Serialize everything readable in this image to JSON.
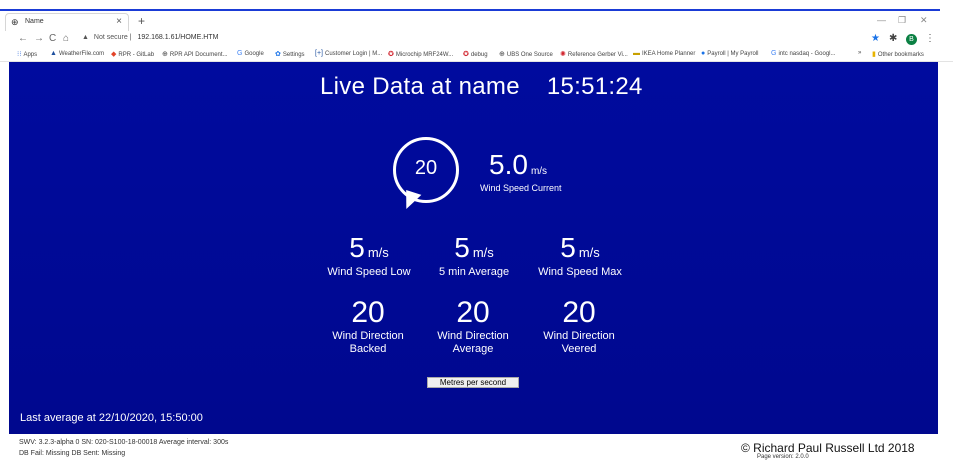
{
  "browser": {
    "tab_title": "Name",
    "tab_icon": "globe-icon",
    "address": {
      "security": "Not secure",
      "url": "192.168.1.61/HOME.HTM"
    },
    "bookmarks": [
      {
        "label": "Apps",
        "icon": "apps-grid-icon"
      },
      {
        "label": "WeatherFile.com",
        "icon": "weatherfile-icon"
      },
      {
        "label": "RPR - GitLab",
        "icon": "gitlab-icon"
      },
      {
        "label": "RPR API Document...",
        "icon": "globe-icon"
      },
      {
        "label": "Google",
        "icon": "google-icon"
      },
      {
        "label": "Settings",
        "icon": "gear-icon"
      },
      {
        "label": "Customer Login | M...",
        "icon": "bracket-icon"
      },
      {
        "label": "Microchip MRF24W...",
        "icon": "microchip-icon"
      },
      {
        "label": "debug",
        "icon": "microchip-icon"
      },
      {
        "label": "UBS One Source",
        "icon": "globe-icon"
      },
      {
        "label": "Reference Gerber Vi...",
        "icon": "reference-icon"
      },
      {
        "label": "IKEA Home Planner",
        "icon": "ikea-icon"
      },
      {
        "label": "Payroll | My Payroll",
        "icon": "payroll-icon"
      },
      {
        "label": "intc nasdaq - Googl...",
        "icon": "google-icon"
      },
      {
        "label": "Other bookmarks",
        "icon": "folder-icon"
      }
    ],
    "profile_initial": "B",
    "overflow": "»"
  },
  "live": {
    "title": "Live Data at name",
    "time": "15:51:24",
    "direction_current": "20",
    "speed_current": "5.0",
    "speed_current_unit": "m/s",
    "speed_current_label": "Wind Speed Current"
  },
  "stats": [
    {
      "value": "5",
      "unit": "m/s",
      "label": "Wind Speed Low"
    },
    {
      "value": "5",
      "unit": "m/s",
      "label": "5 min Average"
    },
    {
      "value": "5",
      "unit": "m/s",
      "label": "Wind Speed Max"
    }
  ],
  "directions": [
    {
      "value": "20",
      "label_line1": "Wind Direction",
      "label_line2": "Backed"
    },
    {
      "value": "20",
      "label_line1": "Wind Direction",
      "label_line2": "Average"
    },
    {
      "value": "20",
      "label_line1": "Wind Direction",
      "label_line2": "Veered"
    }
  ],
  "units_button": "Metres per second",
  "last_average": "Last average at 22/10/2020, 15:50:00",
  "footer": {
    "line1": "SWV: 3.2.3-alpha 0 SN: 020-S100-18-00018 Average interval: 300s",
    "line2": "DB Fail: Missing DB Sent: Missing",
    "copyright": "© Richard Paul Russell Ltd 2018",
    "page_version": "Page version: 2.0.0"
  },
  "colors": {
    "background": "#000a9c",
    "text": "#ffffff"
  }
}
